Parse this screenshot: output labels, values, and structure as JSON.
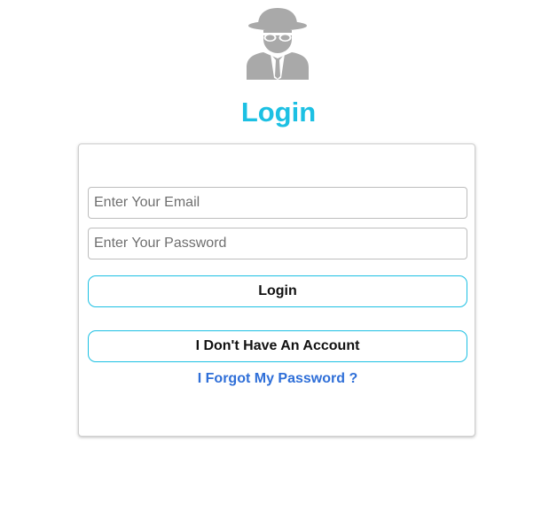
{
  "header": {
    "logo_icon": "spy-incognito-icon",
    "title": "Login",
    "title_color": "#1cc0e3"
  },
  "form": {
    "email_placeholder": "Enter Your Email",
    "email_value": "",
    "password_placeholder": "Enter Your Password",
    "password_value": "",
    "login_label": "Login",
    "no_account_label": "I Don't Have An Account",
    "forgot_label": "I Forgot My Password ?"
  },
  "colors": {
    "accent": "#1cc0e3",
    "link": "#2f6fd8",
    "icon_gray": "#a9a9a9"
  }
}
